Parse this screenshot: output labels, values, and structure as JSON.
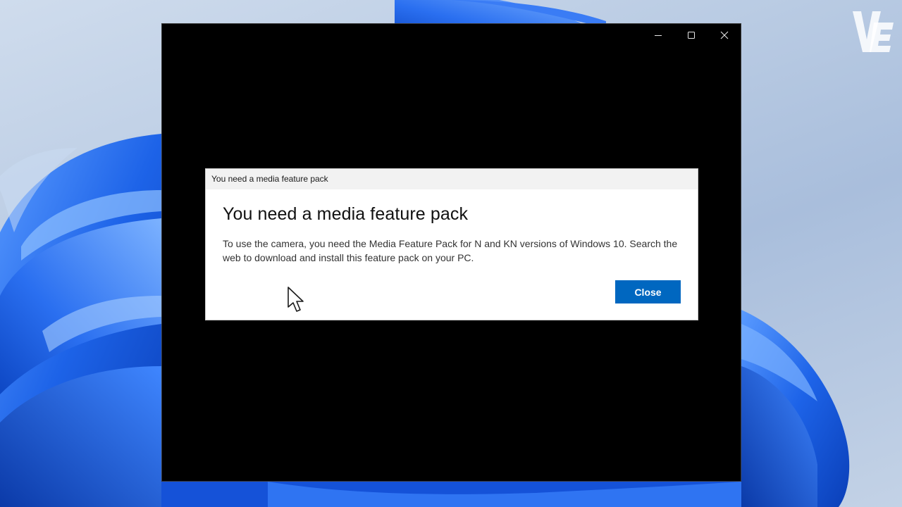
{
  "window": {
    "minimize_glyph": "—",
    "maximize_glyph": "□",
    "close_glyph": "✕"
  },
  "dialog": {
    "title_bar_text": "You need a media feature pack",
    "heading": "You need a media feature pack",
    "message": "To use the camera, you need the Media Feature Pack for N and KN versions of Windows 10. Search the web to download and install this feature pack on your PC.",
    "close_label": "Close"
  },
  "watermark": {
    "text": "VE"
  },
  "colors": {
    "accent": "#0067c0",
    "window_background": "#000000",
    "dialog_background": "#ffffff",
    "wallpaper_blue": "#1a5fe0"
  },
  "icons": [
    "minimize-icon",
    "maximize-icon",
    "close-icon",
    "mouse-pointer-icon",
    "channel-logo-icon"
  ]
}
